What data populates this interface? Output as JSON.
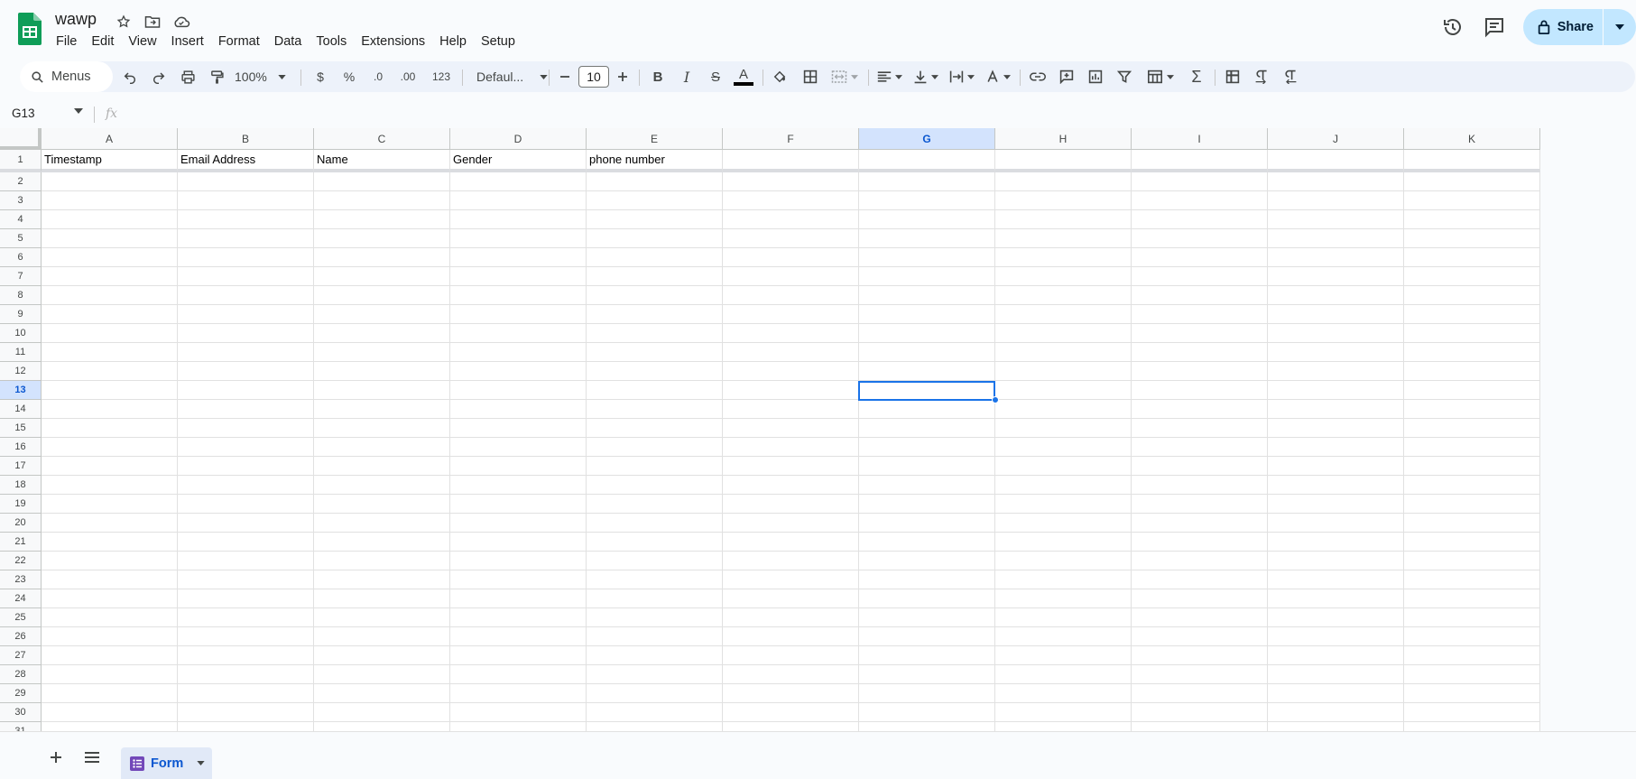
{
  "app": {
    "doc_title": "wawp",
    "menu": [
      "File",
      "Edit",
      "View",
      "Insert",
      "Format",
      "Data",
      "Tools",
      "Extensions",
      "Help",
      "Setup"
    ],
    "share_label": "Share"
  },
  "toolbar": {
    "menus_label": "Menus",
    "zoom": "100%",
    "currency": "$",
    "percent": "%",
    "decrease_decimal": ".0",
    "increase_decimal": ".00",
    "number_format": "123",
    "font": "Defaul...",
    "font_size": "10"
  },
  "formula_bar": {
    "name_box": "G13",
    "fx": "fx",
    "value": ""
  },
  "sheet": {
    "columns": [
      "A",
      "B",
      "C",
      "D",
      "E",
      "F",
      "G",
      "H",
      "I",
      "J",
      "K"
    ],
    "selected_column": "G",
    "selected_row": 13,
    "header_row": [
      "Timestamp",
      "Email Address",
      "Name",
      "Gender",
      "phone number",
      "",
      "",
      "",
      "",
      "",
      ""
    ],
    "row_count": 31
  },
  "bottom": {
    "tabs": [
      {
        "label": "Form",
        "active": true
      }
    ]
  },
  "colors": {
    "accent": "#0b57d0",
    "selection": "#1a73e8",
    "share_bg": "#c2e7ff",
    "sheets_green": "#0f9d58",
    "form_purple": "#7248b9"
  }
}
